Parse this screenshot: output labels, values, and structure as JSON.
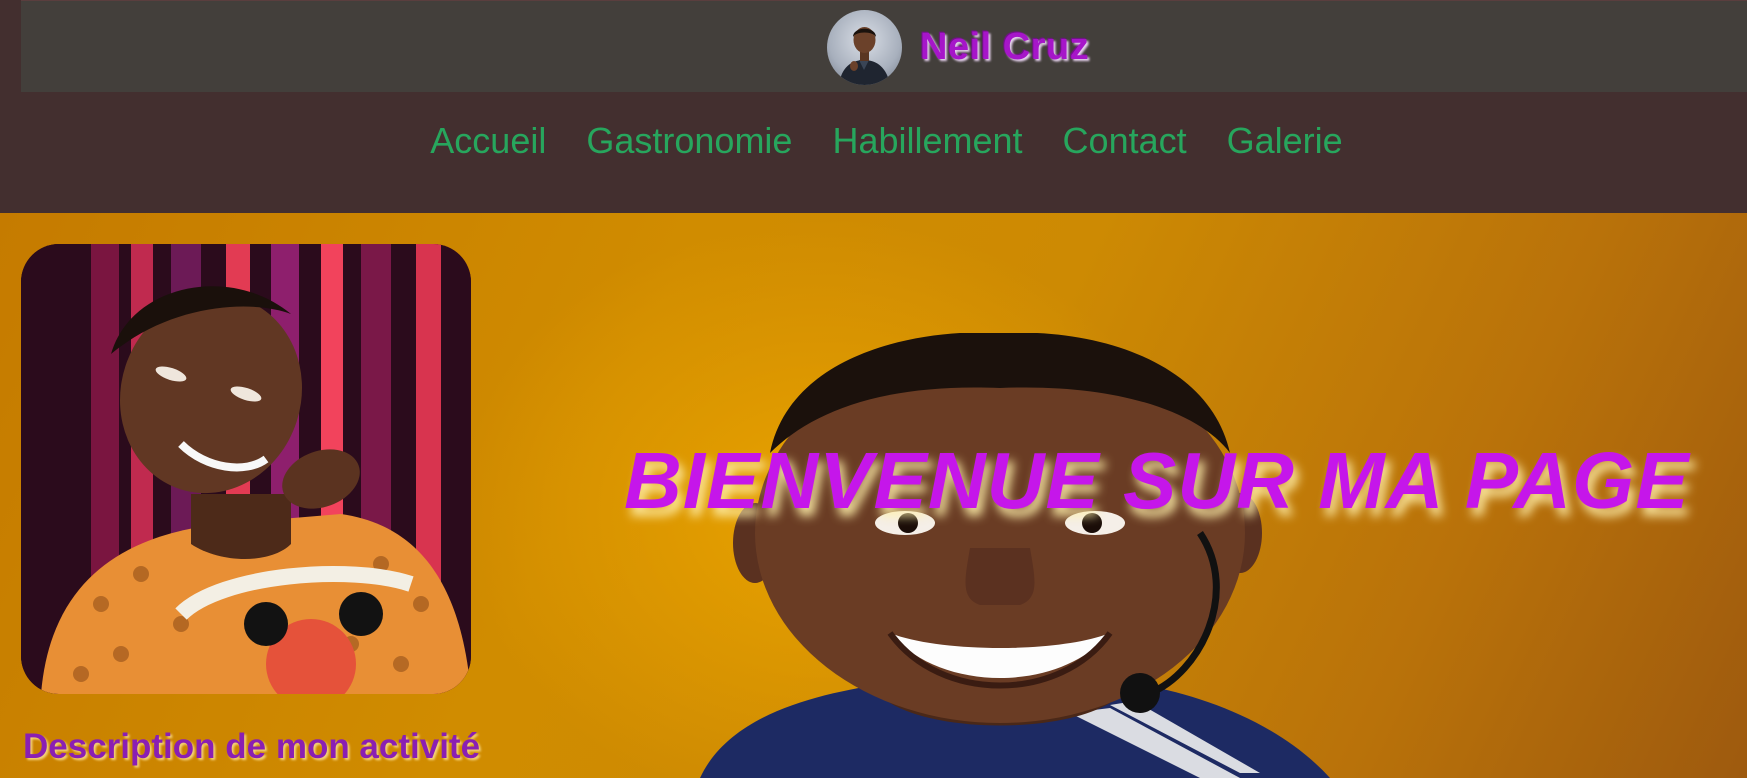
{
  "header": {
    "site_name": "Neil Cruz",
    "avatar_icon": "avatar-photo"
  },
  "nav": {
    "items": [
      {
        "label": "Accueil"
      },
      {
        "label": "Gastronomie"
      },
      {
        "label": "Habillement"
      },
      {
        "label": "Contact"
      },
      {
        "label": "Galerie"
      }
    ]
  },
  "hero": {
    "welcome_title": "BIENVENUE SUR MA PAGE",
    "description_heading": "Description de mon activité",
    "profile_photo": "profile-photo",
    "background_photo": "hero-background-photo"
  },
  "colors": {
    "header_bg": "#433f3b",
    "nav_bg": "#432f2f",
    "nav_text": "#27a65d",
    "brand_text": "#a616c9",
    "welcome_text": "#c516ea",
    "hero_bg": "#cd8a03"
  }
}
